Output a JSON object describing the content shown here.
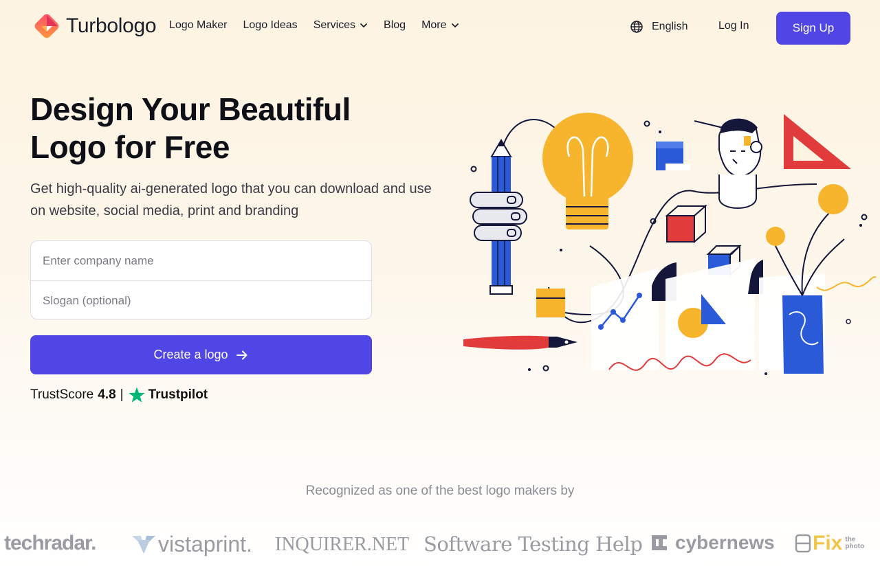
{
  "brand": {
    "name": "Turbologo"
  },
  "nav": {
    "items": [
      {
        "label": "Logo Maker",
        "has_dropdown": false
      },
      {
        "label": "Logo Ideas",
        "has_dropdown": false
      },
      {
        "label": "Services",
        "has_dropdown": true
      },
      {
        "label": "Blog",
        "has_dropdown": false
      },
      {
        "label": "More",
        "has_dropdown": true
      }
    ],
    "language": "English",
    "login": "Log In",
    "signup": "Sign Up"
  },
  "hero": {
    "title_line1": "Design Your Beautiful",
    "title_line2": "Logo for Free",
    "subtitle": "Get high-quality ai-generated logo that you can download and use on website, social media, print and branding",
    "company_placeholder": "Enter company name",
    "slogan_placeholder": "Slogan (optional)",
    "cta_label": "Create a logo",
    "trust_label": "TrustScore",
    "trust_score": "4.8",
    "trust_separator": "|",
    "trustpilot": "Trustpilot"
  },
  "recognized": {
    "heading": "Recognized as one of the best logo makers by",
    "press": {
      "techradar": "techradar.",
      "vistaprint": "vistaprint.",
      "inquirer": "INQUIRER.NET",
      "stg": "Software Testing Help",
      "cybernews": "cybernews",
      "fix": "Fix",
      "fix_small_1": "the",
      "fix_small_2": "photo"
    }
  },
  "colors": {
    "accent": "#4f46e5",
    "background": "#fdf3e1",
    "trustpilot_green": "#00b67a",
    "illustration_yellow": "#f6b52c",
    "illustration_blue": "#2a5ad8",
    "illustration_red": "#e23b3b",
    "illustration_navy": "#14163a"
  },
  "icons": {
    "brand": "turbologo-mark-icon",
    "dropdown": "chevron-down-icon",
    "language": "globe-icon",
    "cta": "arrow-right-icon",
    "trustpilot": "trustpilot-star-icon"
  }
}
